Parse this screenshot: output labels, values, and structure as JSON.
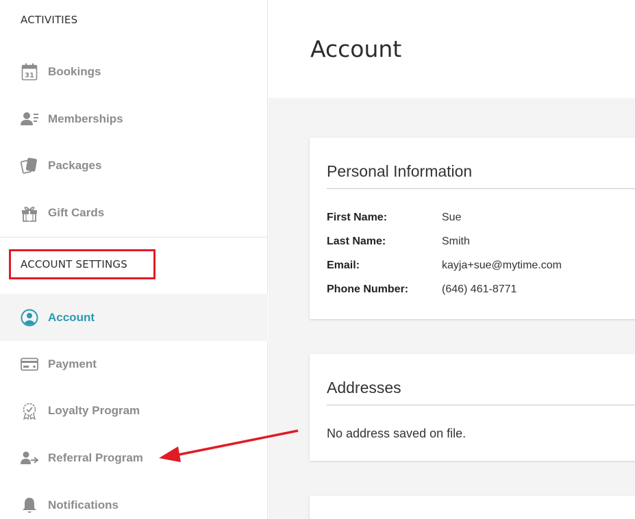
{
  "sidebar": {
    "activities_title": "ACTIVITIES",
    "activities": [
      {
        "label": "Bookings",
        "icon": "calendar-icon",
        "badge": "31"
      },
      {
        "label": "Memberships",
        "icon": "member-card-icon"
      },
      {
        "label": "Packages",
        "icon": "packages-icon"
      },
      {
        "label": "Gift Cards",
        "icon": "gift-icon"
      }
    ],
    "account_settings_title": "ACCOUNT SETTINGS",
    "settings": [
      {
        "label": "Account",
        "icon": "user-circle-icon",
        "active": true
      },
      {
        "label": "Payment",
        "icon": "credit-card-icon"
      },
      {
        "label": "Loyalty Program",
        "icon": "award-badge-icon"
      },
      {
        "label": "Referral Program",
        "icon": "referral-icon"
      },
      {
        "label": "Notifications",
        "icon": "bell-icon"
      }
    ]
  },
  "main": {
    "title": "Account",
    "personal": {
      "title": "Personal Information",
      "rows": [
        {
          "key": "First Name:",
          "value": "Sue"
        },
        {
          "key": "Last Name:",
          "value": "Smith"
        },
        {
          "key": "Email:",
          "value": "kayja+sue@mytime.com"
        },
        {
          "key": "Phone Number:",
          "value": "(646) 461-8771"
        }
      ]
    },
    "addresses": {
      "title": "Addresses",
      "empty": "No address saved on file."
    }
  },
  "colors": {
    "accent": "#2a9ab0",
    "highlight": "#e01b24",
    "muted_text": "#8c8c8c",
    "panel_bg": "#f4f4f4"
  }
}
